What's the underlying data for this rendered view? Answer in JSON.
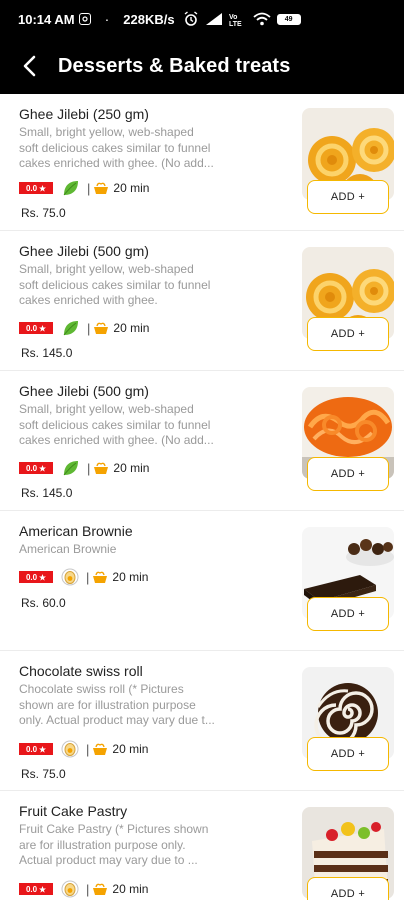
{
  "status_bar": {
    "time": "10:14 AM",
    "separator": "·",
    "speed": "228KB/s",
    "battery": "49",
    "icons": [
      "instagram-icon",
      "alarm-icon",
      "signal-icon",
      "volte-icon",
      "wifi-icon",
      "battery-icon"
    ]
  },
  "header": {
    "title": "Desserts & Baked treats",
    "back_icon": "back-arrow-icon"
  },
  "colors": {
    "header_bg": "#000000",
    "rating_badge": "#e8161a",
    "add_button_border": "#f5b800",
    "veg_leaf": "#5fb833",
    "time_icon": "#f5a300"
  },
  "items": [
    {
      "name": "Ghee Jilebi (250 gm)",
      "description": "Small, bright yellow, web-shaped\nsoft delicious cakes similar to funnel\ncakes enriched with ghee. (No add...",
      "rating": "0.0",
      "diet_icon": "veg-leaf-icon",
      "separator": "|",
      "prep_time": "20 min",
      "price": "Rs. 75.0",
      "add_label": "ADD +"
    },
    {
      "name": "Ghee Jilebi (500 gm)",
      "description": "Small, bright yellow, web-shaped\nsoft delicious cakes similar to funnel\ncakes enriched with ghee.",
      "rating": "0.0",
      "diet_icon": "veg-leaf-icon",
      "separator": "|",
      "prep_time": "20 min",
      "price": "Rs. 145.0",
      "add_label": "ADD +"
    },
    {
      "name": "Ghee Jilebi (500 gm)",
      "description": "Small, bright yellow, web-shaped\nsoft delicious cakes similar to funnel\ncakes enriched with ghee. (No add...",
      "rating": "0.0",
      "diet_icon": "veg-leaf-icon",
      "separator": "|",
      "prep_time": "20 min",
      "price": "Rs. 145.0",
      "add_label": "ADD +"
    },
    {
      "name": "American Brownie",
      "description": "American Brownie",
      "rating": "0.0",
      "diet_icon": "egg-icon",
      "separator": "|",
      "prep_time": "20 min",
      "price": "Rs. 60.0",
      "add_label": "ADD +"
    },
    {
      "name": "Chocolate swiss roll",
      "description": "Chocolate swiss roll (* Pictures\nshown are for illustration purpose\nonly. Actual product may vary due t...",
      "rating": "0.0",
      "diet_icon": "egg-icon",
      "separator": "|",
      "prep_time": "20 min",
      "price": "Rs. 75.0",
      "add_label": "ADD +"
    },
    {
      "name": "Fruit Cake Pastry",
      "description": "Fruit Cake Pastry  (* Pictures shown\nare for illustration purpose only.\nActual product may vary due to ...",
      "rating": "0.0",
      "diet_icon": "egg-icon",
      "separator": "|",
      "prep_time": "20 min",
      "price": "",
      "add_label": "ADD +"
    }
  ]
}
